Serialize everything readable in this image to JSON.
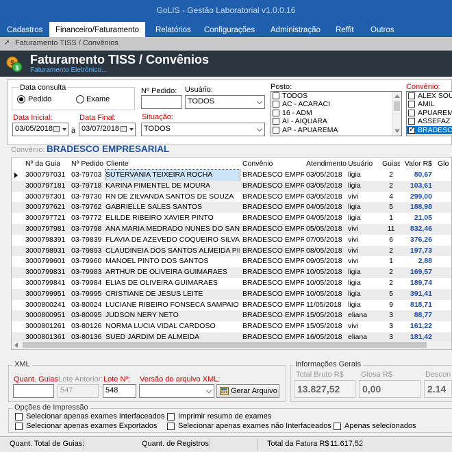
{
  "window": {
    "title": "GoLIS - Gestão Laboratorial v1.0.0.16"
  },
  "menu": [
    {
      "label": "Cadastros"
    },
    {
      "label": "Financeiro/Faturamento"
    },
    {
      "label": "Relatórios"
    },
    {
      "label": "Configurações"
    },
    {
      "label": "Administração"
    },
    {
      "label": "Reffit"
    },
    {
      "label": "Outros"
    }
  ],
  "breadcrumb": "Faturamento TISS / Convênios",
  "header": {
    "title": "Faturamento TISS / Convênios",
    "subtitle": "Faturamento Eletrônico..."
  },
  "filters": {
    "data_consulta_label": "Data consulta",
    "radio_pedido": "Pedido",
    "radio_exame": "Exame",
    "pedido_label": "Nº Pedido:",
    "pedido_value": "",
    "usuario_label": "Usuário:",
    "usuario_value": "TODOS",
    "data_inicial_label": "Data Inicial:",
    "data_inicial_value": "03/05/2018",
    "data_final_label": "Data Final:",
    "data_final_value": "03/07/2018",
    "a_label": "à",
    "situacao_label": "Situação:",
    "situacao_value": "TODOS",
    "posto_label": "Posto:",
    "posto_items": [
      "TODOS",
      "AC - ACARACI",
      "16 - ADM",
      "AI - AIQUARA",
      "AP - APUAREMA"
    ],
    "convenio_label": "Convênio:",
    "convenio_items": [
      "ALEX SOUZA",
      "AMIL",
      "APUAREMA",
      "ASSEFAZ",
      "BRADESCO EMPRESARIAL"
    ]
  },
  "convenio_title": {
    "label": "Convênio:",
    "value": "BRADESCO EMPRESARIAL"
  },
  "table": {
    "columns": [
      "Nº da Guia",
      "Nº Pedido",
      "Cliente",
      "Convênio",
      "Atendimento",
      "Usuário",
      "Guias.",
      "Valor R$",
      "Glo"
    ],
    "rows": [
      [
        "3000797031",
        "03-79703",
        "SUTERVANIA TEIXEIRA ROCHA",
        "BRADESCO EMPRES",
        "03/05/2018",
        "ligia",
        "2",
        "80,67"
      ],
      [
        "3000797181",
        "03-79718",
        "KARINA PIMENTEL DE MOURA",
        "BRADESCO EMPRES",
        "03/05/2018",
        "ligia",
        "2",
        "103,61"
      ],
      [
        "3000797301",
        "03-79730",
        "RN DE ZILVANDA SANTOS DE SOUZA",
        "BRADESCO EMPRES",
        "03/05/2018",
        "vivi",
        "4",
        "299,00"
      ],
      [
        "3000797621",
        "03-79762",
        "GABRIELLE SALES SANTOS",
        "BRADESCO EMPRES",
        "04/05/2018",
        "ligia",
        "5",
        "188,98"
      ],
      [
        "3000797721",
        "03-79772",
        "ELILDE RIBEIRO XAVIER PINTO",
        "BRADESCO EMPRES",
        "04/05/2018",
        "ligia",
        "1",
        "21,05"
      ],
      [
        "3000797981",
        "03-79798",
        "ANA MARIA MEDRADO NUNES DO SANTOS",
        "BRADESCO EMPRES",
        "05/05/2018",
        "vivi",
        "11",
        "832,46"
      ],
      [
        "3000798391",
        "03-79839",
        "FLAVIA DE AZEVEDO COQUEIRO SILVA",
        "BRADESCO EMPRES",
        "07/05/2018",
        "vivi",
        "6",
        "376,26"
      ],
      [
        "3000798931",
        "03-79893",
        "CLAUDINEIA DOS SANTOS ALMEIDA PIRES",
        "BRADESCO EMPRES",
        "08/05/2018",
        "vivi",
        "2",
        "197,73"
      ],
      [
        "3000799601",
        "03-79960",
        "MANOEL PINTO DOS SANTOS",
        "BRADESCO EMPRES",
        "09/05/2018",
        "vivi",
        "1",
        "2,88"
      ],
      [
        "3000799831",
        "03-79983",
        "ARTHUR DE OLIVEIRA GUIMARAES",
        "BRADESCO EMPRES",
        "10/05/2018",
        "ligia",
        "2",
        "169,57"
      ],
      [
        "3000799841",
        "03-79984",
        "ELIAS DE OLIVEIRA GUIMARAES",
        "BRADESCO EMPRES",
        "10/05/2018",
        "ligia",
        "2",
        "189,74"
      ],
      [
        "3000799951",
        "03-79995",
        "CRISTIANE DE JESUS LEITE",
        "BRADESCO EMPRES",
        "10/05/2018",
        "ligia",
        "5",
        "391,41"
      ],
      [
        "3000800241",
        "03-80024",
        "LUCIANE RIBEIRO FONSECA SAMPAIO",
        "BRADESCO EMPRES",
        "11/05/2018",
        "ligia",
        "9",
        "818,71"
      ],
      [
        "3000800951",
        "03-80095",
        "JUDSON NERY NETO",
        "BRADESCO EMPRES",
        "15/05/2018",
        "eliana",
        "3",
        "88,77"
      ],
      [
        "3000801261",
        "03-80126",
        "NORMA LUCIA VIDAL CARDOSO",
        "BRADESCO EMPRES",
        "15/05/2018",
        "vivi",
        "3",
        "161,22"
      ],
      [
        "3000801361",
        "03-80136",
        "SUED JARDIM DE ALMEIDA",
        "BRADESCO EMPRES",
        "16/05/2018",
        "eliana",
        "3",
        "181,42"
      ]
    ]
  },
  "xml": {
    "title": "XML",
    "quant_guias_label": "Quant. Guias:",
    "quant_guias_value": "",
    "lote_anterior_label": "Lote Anterior:",
    "lote_anterior_value": "547",
    "lote_label": "Lote Nº:",
    "lote_value": "548",
    "versao_label": "Versão do arquivo XML:",
    "versao_value": "",
    "gerar_button": "Gerar Arquivo"
  },
  "info": {
    "title": "Informações Gerais",
    "total_bruto_label": "Total Bruto R$",
    "total_bruto_value": "13.827,52",
    "glosa_label": "Glosa R$",
    "glosa_value": "0,00",
    "desconto_label": "Descon",
    "desconto_value": "2.14"
  },
  "print_options": {
    "title": "Opções de Impressão",
    "opt1": "Selecionar apenas exames Interfaceados",
    "opt2": "Selecionar apenas exames Exportados",
    "opt3": "Imprimir resumo de exames",
    "opt4": "Selecionar apenas exames não Interfaceados",
    "opt5": "Apenas selecionados"
  },
  "footer": {
    "total_guias_label": "Quant. Total de Guias:",
    "total_guias_value": "",
    "registros_label": "Quant. de Registros:",
    "registros_value": "",
    "total_fatura_label": "Total da Fatura R$",
    "total_fatura_value": "11.617,52"
  },
  "colors": {
    "menu_bg": "#1f5fae",
    "header_bg": "#2a3540",
    "value_blue": "#1e4fa8",
    "label_red": "#cc0000"
  }
}
